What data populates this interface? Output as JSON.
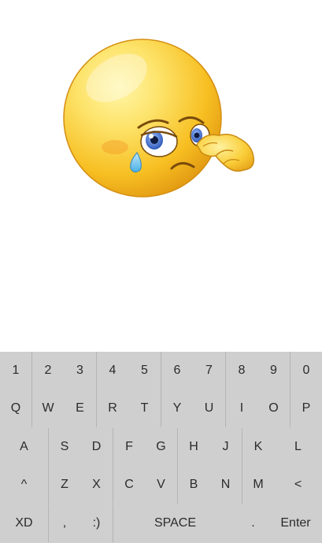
{
  "emoji": {
    "icon": "crying-face-wiping-tear-icon",
    "colors": {
      "face_light": "#fde36a",
      "face_mid": "#f7bf22",
      "face_edge": "#e39b13",
      "tear": "#6fc3ee",
      "outline": "#8a5a12"
    }
  },
  "keyboard": {
    "background": "#cfcfcf",
    "text_color": "#2b2b2b",
    "rows": [
      {
        "keys": [
          {
            "label": "1"
          },
          {
            "label": "2"
          },
          {
            "label": "3"
          },
          {
            "label": "4"
          },
          {
            "label": "5"
          },
          {
            "label": "6"
          },
          {
            "label": "7"
          },
          {
            "label": "8"
          },
          {
            "label": "9"
          },
          {
            "label": "0"
          }
        ]
      },
      {
        "keys": [
          {
            "label": "Q"
          },
          {
            "label": "W"
          },
          {
            "label": "E"
          },
          {
            "label": "R"
          },
          {
            "label": "T"
          },
          {
            "label": "Y"
          },
          {
            "label": "U"
          },
          {
            "label": "I"
          },
          {
            "label": "O"
          },
          {
            "label": "P"
          }
        ]
      },
      {
        "keys": [
          {
            "label": "A"
          },
          {
            "label": "S"
          },
          {
            "label": "D"
          },
          {
            "label": "F"
          },
          {
            "label": "G"
          },
          {
            "label": "H"
          },
          {
            "label": "J"
          },
          {
            "label": "K"
          },
          {
            "label": "L"
          }
        ]
      },
      {
        "keys": [
          {
            "label": "^"
          },
          {
            "label": "Z"
          },
          {
            "label": "X"
          },
          {
            "label": "C"
          },
          {
            "label": "V"
          },
          {
            "label": "B"
          },
          {
            "label": "N"
          },
          {
            "label": "M"
          },
          {
            "label": "<"
          }
        ]
      },
      {
        "keys": [
          {
            "label": "XD"
          },
          {
            "label": ","
          },
          {
            "label": ":)"
          },
          {
            "label": "SPACE"
          },
          {
            "label": "."
          },
          {
            "label": "Enter"
          }
        ]
      }
    ]
  }
}
